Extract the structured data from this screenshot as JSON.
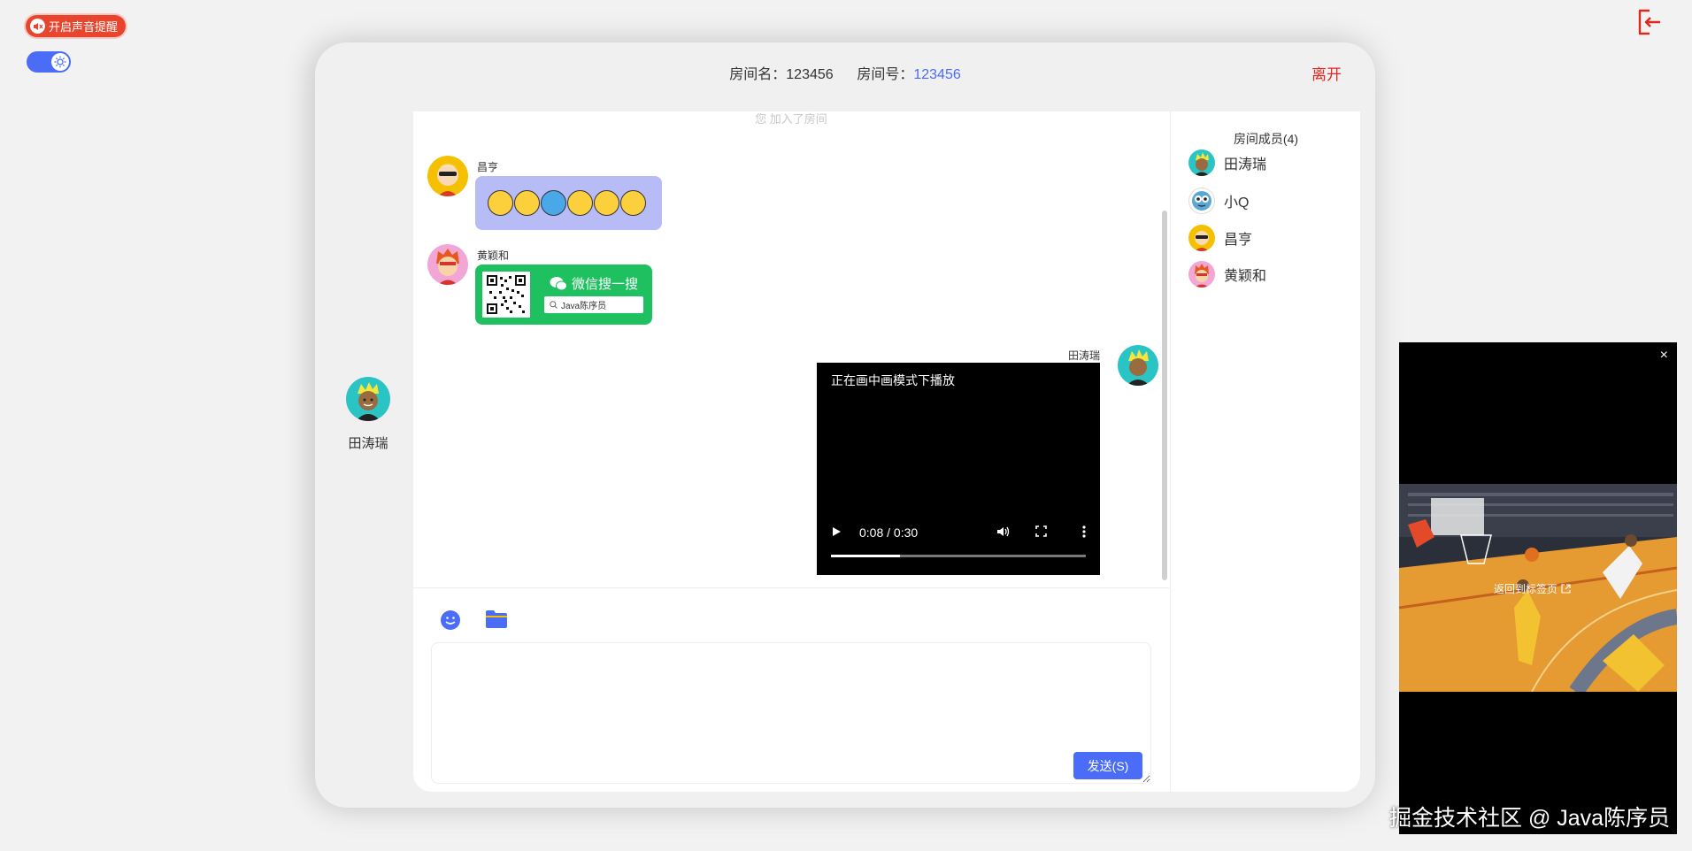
{
  "top_controls": {
    "sound_alert_label": "开启声音提醒",
    "theme_icon": "sun-icon",
    "exit_icon": "logout-icon"
  },
  "room": {
    "name_label": "房间名：",
    "name_value": "123456",
    "id_label": "房间号：",
    "id_value": "123456",
    "leave_label": "离开"
  },
  "self_user": {
    "name": "田涛瑞"
  },
  "chat": {
    "system_note": "您 加入了房间",
    "messages": [
      {
        "sender": "昌亨",
        "type": "emoji"
      },
      {
        "sender": "黄颖和",
        "type": "wechat-card",
        "card_title": "微信搜一搜",
        "card_search": "Java陈序员"
      },
      {
        "sender": "田涛瑞",
        "type": "video",
        "pip_note": "正在画中画模式下播放",
        "time": "0:08 / 0:30",
        "progress": 0.27
      }
    ]
  },
  "toolbar": {
    "emoji_icon": "smile-icon",
    "file_icon": "folder-icon"
  },
  "input": {
    "placeholder": ""
  },
  "send_label": "发送(S)",
  "members": {
    "title": "房间成员(4)",
    "list": [
      "田涛瑞",
      "小Q",
      "昌亨",
      "黄颖和"
    ]
  },
  "pip_window": {
    "close_label": "×",
    "back_label": "返回到标签页"
  },
  "watermark": "掘金技术社区 @ Java陈序员",
  "colors": {
    "accent": "#4a6cf7",
    "danger": "#e0281e",
    "wechat": "#1ec05f",
    "bubble": "#b7bcf7"
  }
}
